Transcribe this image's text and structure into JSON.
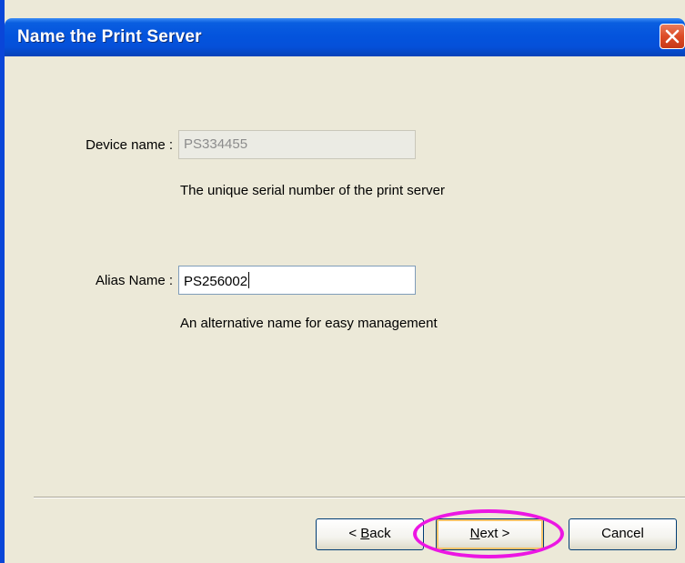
{
  "window": {
    "title": "Name the Print Server"
  },
  "form": {
    "device_name_label": "Device name :",
    "device_name_value": "PS334455",
    "device_name_hint": "The unique serial number of the print server",
    "alias_name_label": "Alias Name :",
    "alias_name_value": "PS256002",
    "alias_name_hint": "An alternative name for easy management"
  },
  "buttons": {
    "back_prefix": "< ",
    "back_mnemonic": "B",
    "back_rest": "ack",
    "next_mnemonic": "N",
    "next_rest": "ext >",
    "cancel_label": "Cancel"
  },
  "icons": {
    "close": "close-icon"
  },
  "colors": {
    "titlebar": "#0454dd",
    "dialog_background": "#ece9d8",
    "close_button": "#dd4b26",
    "highlight_ellipse": "#ec16e3"
  }
}
